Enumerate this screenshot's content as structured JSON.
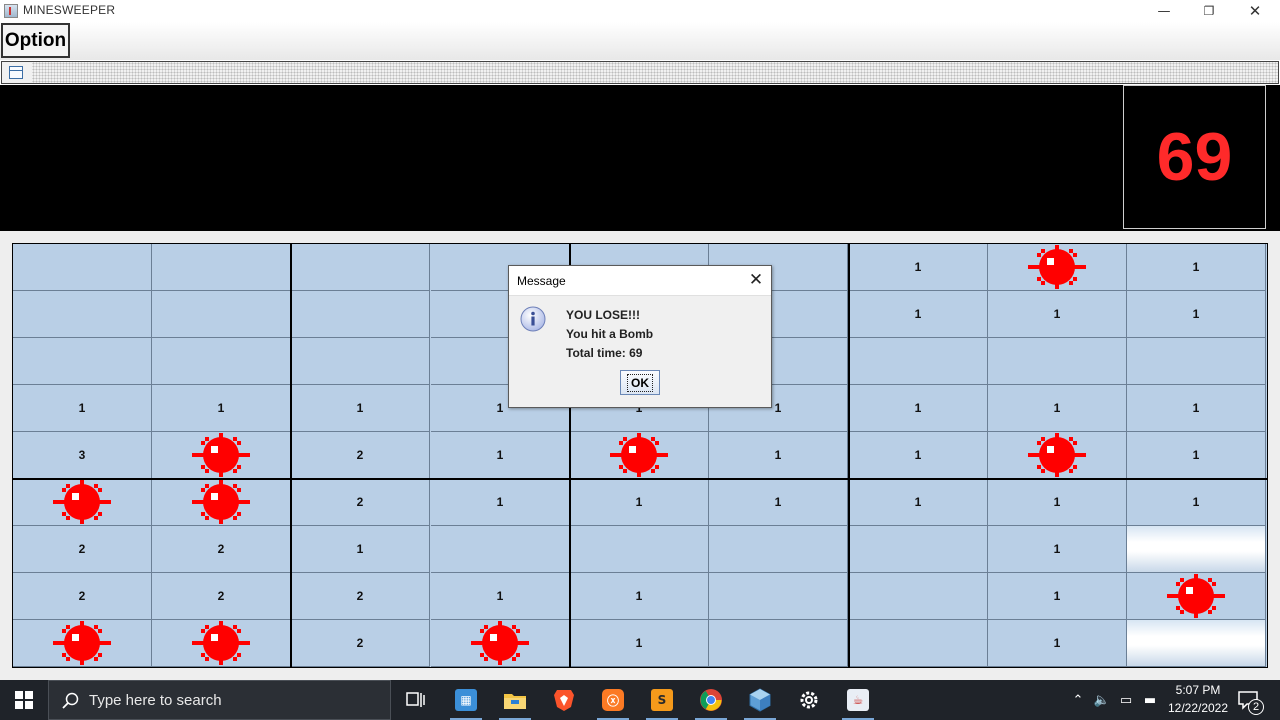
{
  "window": {
    "title": "MINESWEEPER",
    "controls": {
      "minimize": "—",
      "maximize": "❐",
      "close": "✕"
    }
  },
  "menu": {
    "option_label": "Option"
  },
  "header": {
    "timer": "69",
    "timer_color": "#ff2a2a"
  },
  "board": {
    "rows": 9,
    "cols": 9,
    "cells": [
      [
        "",
        "",
        "",
        "",
        "",
        "",
        "1",
        "B",
        "1"
      ],
      [
        "",
        "",
        "",
        "",
        "",
        "",
        "1",
        "1",
        "1"
      ],
      [
        "",
        "",
        "",
        "",
        "",
        "",
        "",
        "",
        ""
      ],
      [
        "1",
        "1",
        "1",
        "1",
        "1",
        "1",
        "1",
        "1",
        "1"
      ],
      [
        "3",
        "B",
        "2",
        "1",
        "B",
        "1",
        "1",
        "B",
        "1"
      ],
      [
        "B",
        "B",
        "2",
        "1",
        "1",
        "1",
        "1",
        "1",
        "1"
      ],
      [
        "2",
        "2",
        "1",
        "",
        "",
        "",
        "",
        "1",
        "U"
      ],
      [
        "2",
        "2",
        "2",
        "1",
        "1",
        "",
        "",
        "1",
        "B"
      ],
      [
        "B",
        "B",
        "2",
        "B",
        "1",
        "",
        "",
        "1",
        "U"
      ]
    ],
    "legend": {
      "B": "bomb",
      "U": "unrevealed"
    },
    "colors": {
      "revealed": "#b9cfe6",
      "bomb": "#ff0000"
    }
  },
  "dialog": {
    "title": "Message",
    "close": "✕",
    "icon": "info-icon",
    "lines": [
      "YOU LOSE!!!",
      "You hit a Bomb",
      "Total time: 69"
    ],
    "ok_label": "OK"
  },
  "taskbar": {
    "search_placeholder": "Type here to search",
    "apps": [
      "task-view-icon",
      "control-panel-icon",
      "file-explorer-icon",
      "brave-icon",
      "xampp-icon",
      "sublime-text-icon",
      "chrome-icon",
      "netbeans-icon",
      "settings-icon",
      "java-icon"
    ],
    "clock_time": "5:07 PM",
    "clock_date": "12/22/2022",
    "notification_count": "2"
  }
}
